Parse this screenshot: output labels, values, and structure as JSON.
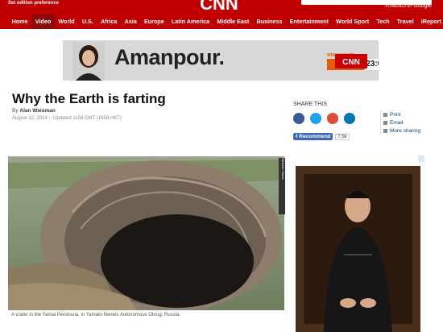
{
  "header": {
    "edition": "Set edition preference",
    "powered_by": "POWERED BY",
    "powered_brand": "Google",
    "logo_text": "CNN",
    "nav": [
      "Home",
      "Video",
      "World",
      "U.S.",
      "Africa",
      "Asia",
      "Europe",
      "Latin America",
      "Middle East",
      "Business",
      "Entertainment",
      "World Sport",
      "Tech",
      "Travel",
      "iReport"
    ],
    "active_nav": "Video"
  },
  "ad": {
    "title": "Amanpour.",
    "weeknights": "WEEKNIGHTS",
    "time1": "20:00",
    "time2": "23:00CET",
    "brand": "CNN"
  },
  "article": {
    "headline": "Why the Earth is farting",
    "byline_prefix": "By",
    "author": "Alan Weisman",
    "date": "August 12, 2014 -- Updated 1158 GMT (1958 HKT)",
    "caption": "A crater in the Yamal Peninsula, in Yamalo-Nenets Autonomous Okrug, Russia.",
    "credit": "Siberian Times"
  },
  "share": {
    "title": "SHARE THIS",
    "recommend": "Recommend",
    "count": "7.5k",
    "links": [
      "Print",
      "Email",
      "More sharing"
    ]
  }
}
